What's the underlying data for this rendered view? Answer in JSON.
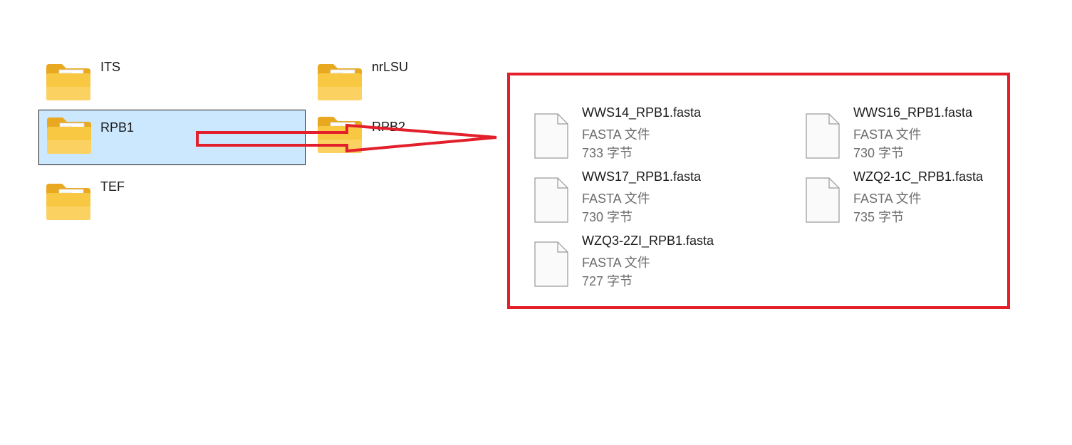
{
  "folders": [
    {
      "label": "ITS",
      "icon": "folder-icon",
      "selected": false
    },
    {
      "label": "nrLSU",
      "icon": "folder-icon",
      "selected": false
    },
    {
      "label": "RPB1",
      "icon": "folder-icon",
      "selected": true
    },
    {
      "label": "RPB2",
      "icon": "folder-icon",
      "selected": false
    },
    {
      "label": "TEF",
      "icon": "folder-icon",
      "selected": false
    }
  ],
  "files": [
    {
      "name": "WWS14_RPB1.fasta",
      "type": "FASTA 文件",
      "size": "733 字节",
      "icon": "file-icon"
    },
    {
      "name": "WWS16_RPB1.fasta",
      "type": "FASTA 文件",
      "size": "730 字节",
      "icon": "file-icon"
    },
    {
      "name": "WWS17_RPB1.fasta",
      "type": "FASTA 文件",
      "size": "730 字节",
      "icon": "file-icon"
    },
    {
      "name": "WZQ2-1C_RPB1.fasta",
      "type": "FASTA 文件",
      "size": "735 字节",
      "icon": "file-icon"
    },
    {
      "name": "WZQ3-2ZI_RPB1.fasta",
      "type": "FASTA 文件",
      "size": "727 字节",
      "icon": "file-icon"
    }
  ],
  "colors": {
    "selection_bg": "#cce8ff",
    "annotation_red": "#e21f2a",
    "folder_yellow": "#f8c843"
  }
}
